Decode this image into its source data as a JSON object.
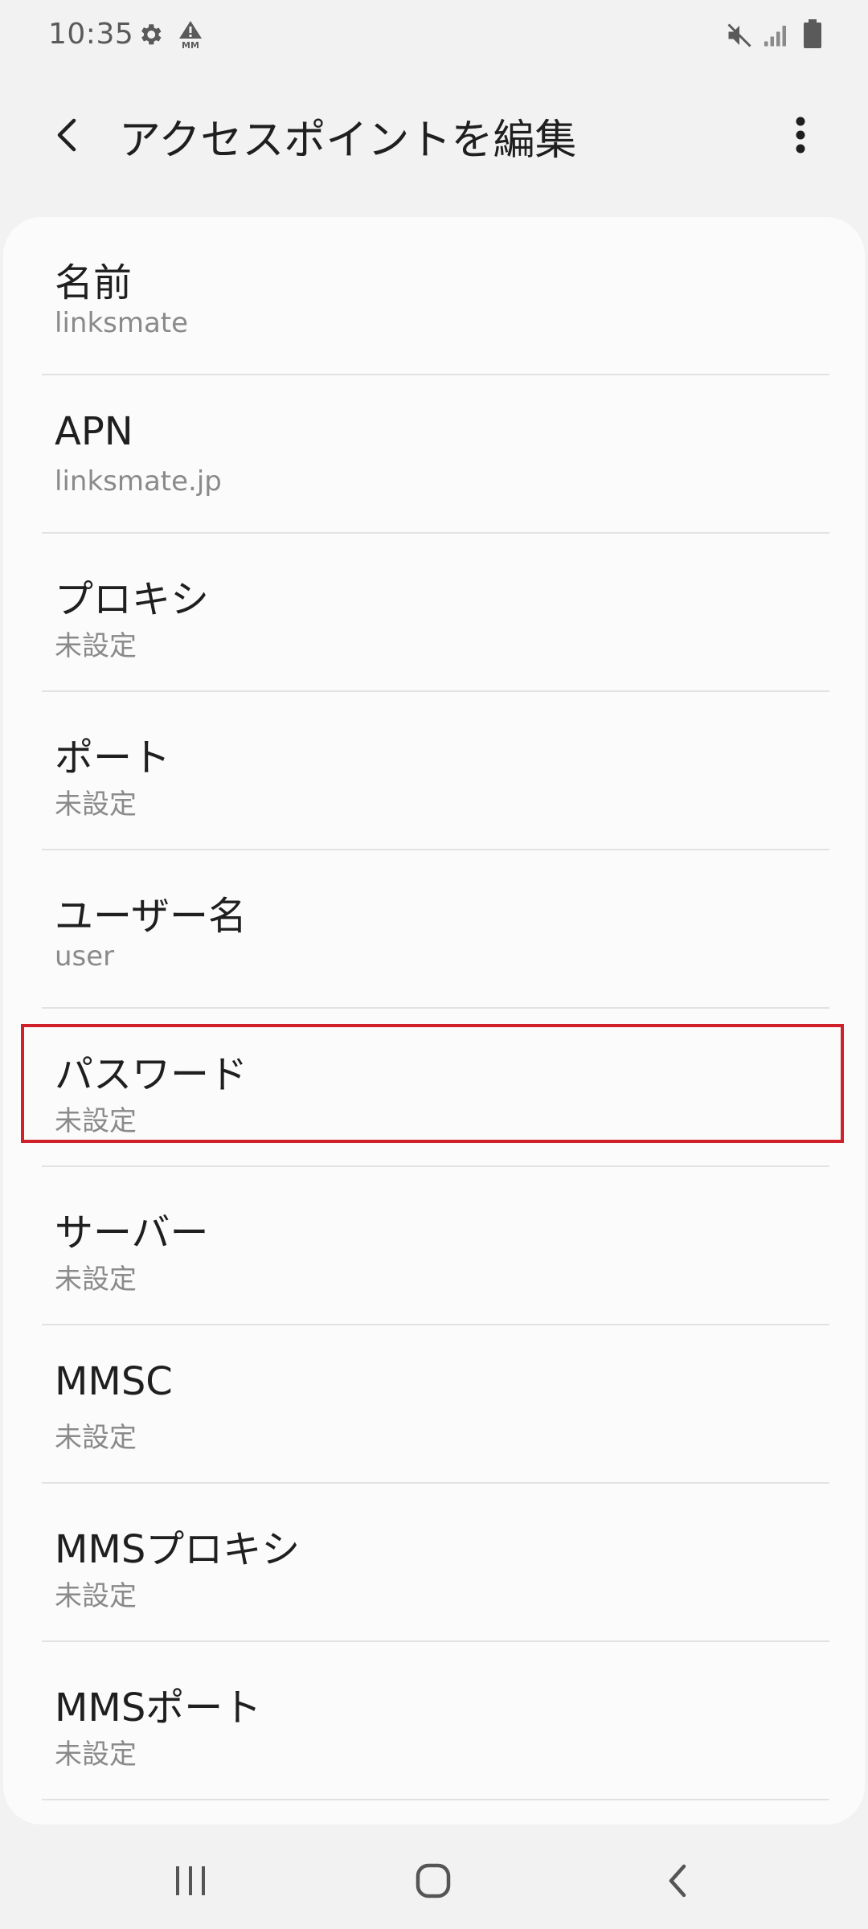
{
  "status_bar": {
    "time": "10:35",
    "icons": [
      "gear-icon",
      "mm-alert-icon",
      "mute-icon",
      "signal-icon",
      "battery-icon"
    ]
  },
  "app_bar": {
    "title": "アクセスポイントを編集",
    "back_icon": "back-chevron-icon",
    "more_icon": "more-vert-icon"
  },
  "settings": [
    {
      "label": "名前",
      "value": "linksmate"
    },
    {
      "label": "APN",
      "value": "linksmate.jp"
    },
    {
      "label": "プロキシ",
      "value": "未設定"
    },
    {
      "label": "ポート",
      "value": "未設定"
    },
    {
      "label": "ユーザー名",
      "value": "user"
    },
    {
      "label": "パスワード",
      "value": "未設定"
    },
    {
      "label": "サーバー",
      "value": "未設定"
    },
    {
      "label": "MMSC",
      "value": "未設定"
    },
    {
      "label": "MMSプロキシ",
      "value": "未設定"
    },
    {
      "label": "MMSポート",
      "value": "未設定"
    }
  ],
  "highlight": {
    "target": "パスワード",
    "color": "#d0202a"
  },
  "nav_bar": {
    "icons": [
      "recent-apps-icon",
      "home-icon",
      "back-icon"
    ]
  },
  "colors": {
    "background": "#f2f2f2",
    "card": "#fbfbfb",
    "secondary_text": "#8a8a8a"
  }
}
